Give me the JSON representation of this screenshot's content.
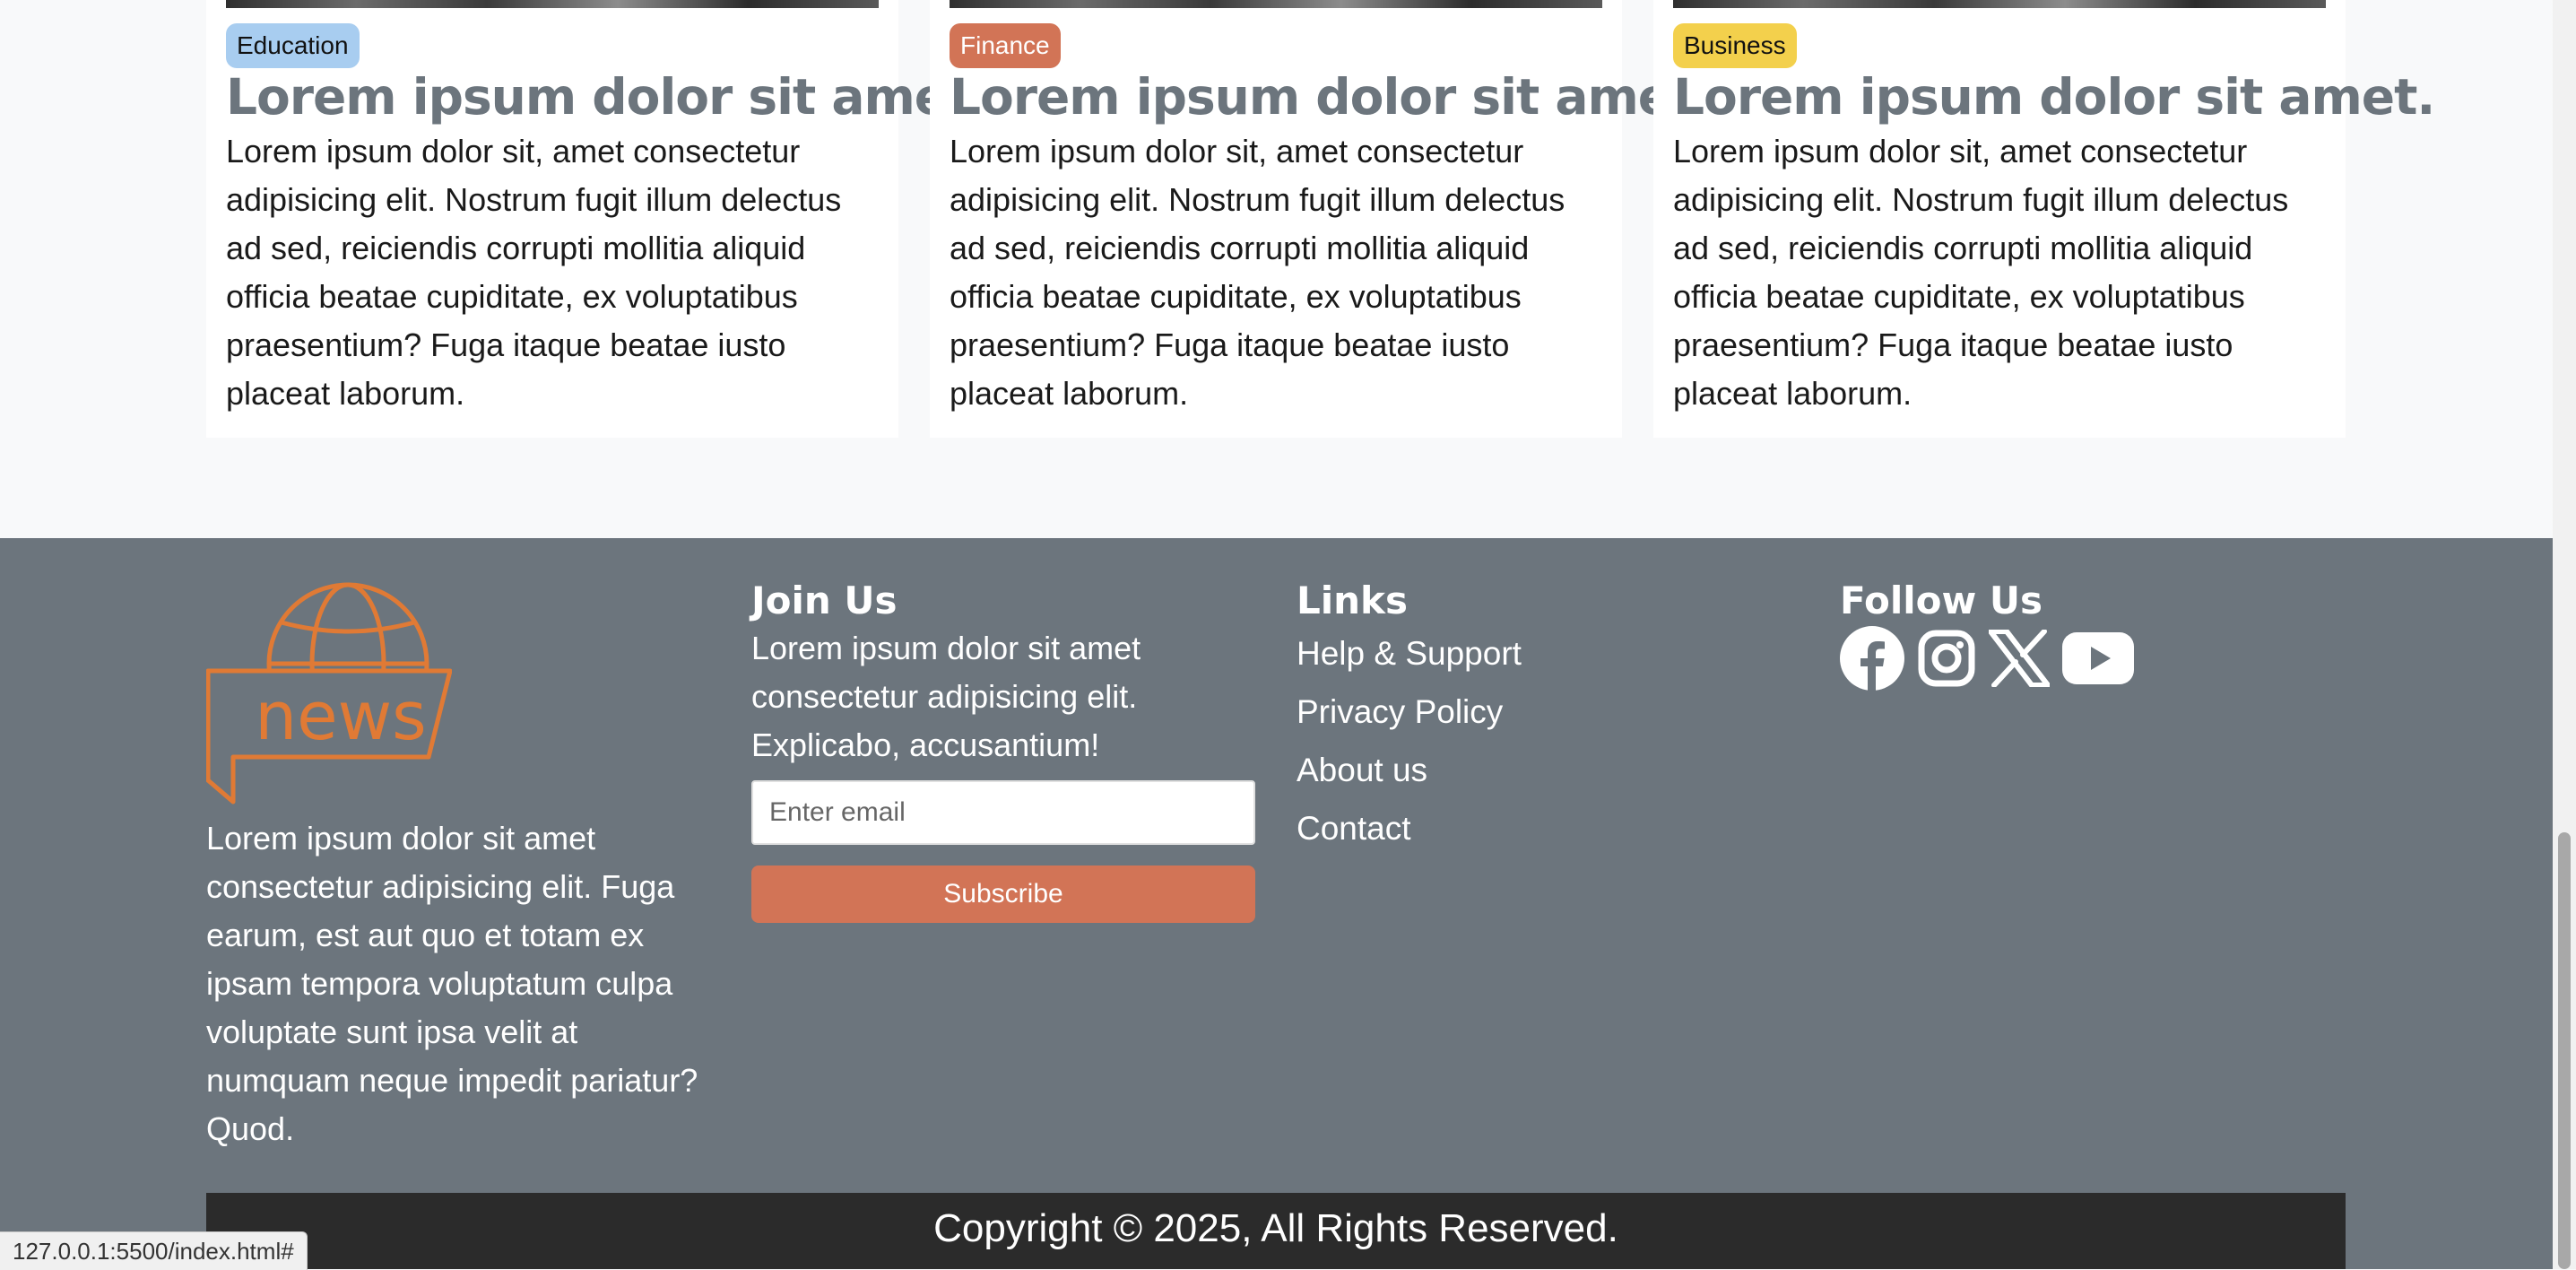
{
  "cards": [
    {
      "badge": "Education",
      "title": "Lorem ipsum dolor sit amet.",
      "text": "Lorem ipsum dolor sit, amet consectetur adipisicing elit. Nostrum fugit illum delectus ad sed, reiciendis corrupti mollitia aliquid officia beatae cupiditate, ex voluptatibus praesentium? Fuga itaque beatae iusto placeat laborum."
    },
    {
      "badge": "Finance",
      "title": "Lorem ipsum dolor sit amet.",
      "text": "Lorem ipsum dolor sit, amet consectetur adipisicing elit. Nostrum fugit illum delectus ad sed, reiciendis corrupti mollitia aliquid officia beatae cupiditate, ex voluptatibus praesentium? Fuga itaque beatae iusto placeat laborum."
    },
    {
      "badge": "Business",
      "title": "Lorem ipsum dolor sit amet.",
      "text": "Lorem ipsum dolor sit, amet consectetur adipisicing elit. Nostrum fugit illum delectus ad sed, reiciendis corrupti mollitia aliquid officia beatae cupiditate, ex voluptatibus praesentium? Fuga itaque beatae iusto placeat laborum."
    }
  ],
  "footer": {
    "logo_text": "news",
    "about_text": "Lorem ipsum dolor sit amet consectetur adipisicing elit. Fuga earum, est aut quo et totam ex ipsam tempora voluptatum culpa voluptate sunt ipsa velit at numquam neque impedit pariatur? Quod.",
    "join": {
      "title": "Join Us",
      "text": "Lorem ipsum dolor sit amet consectetur adipisicing elit. Explicabo, accusantium!",
      "email_placeholder": "Enter email",
      "email_value": "",
      "subscribe_label": "Subscribe"
    },
    "links": {
      "title": "Links",
      "items": [
        "Help & Support",
        "Privacy Policy",
        "About us",
        "Contact"
      ]
    },
    "follow": {
      "title": "Follow Us",
      "icons": [
        "facebook-icon",
        "instagram-icon",
        "x-icon",
        "youtube-icon"
      ]
    },
    "copyright": "Copyright © 2025, All Rights Reserved."
  },
  "status_bar": {
    "url": "127.0.0.1:5500/index.html#"
  },
  "colors": {
    "page_bg": "#f8f9fa",
    "footer_bg": "#6c757d",
    "copyright_bg": "#2b2b2b",
    "accent": "#d27456",
    "education_badge": "#a8cdf0",
    "finance_badge": "#d27456",
    "business_badge": "#f3d04c",
    "logo": "#e07a35"
  }
}
